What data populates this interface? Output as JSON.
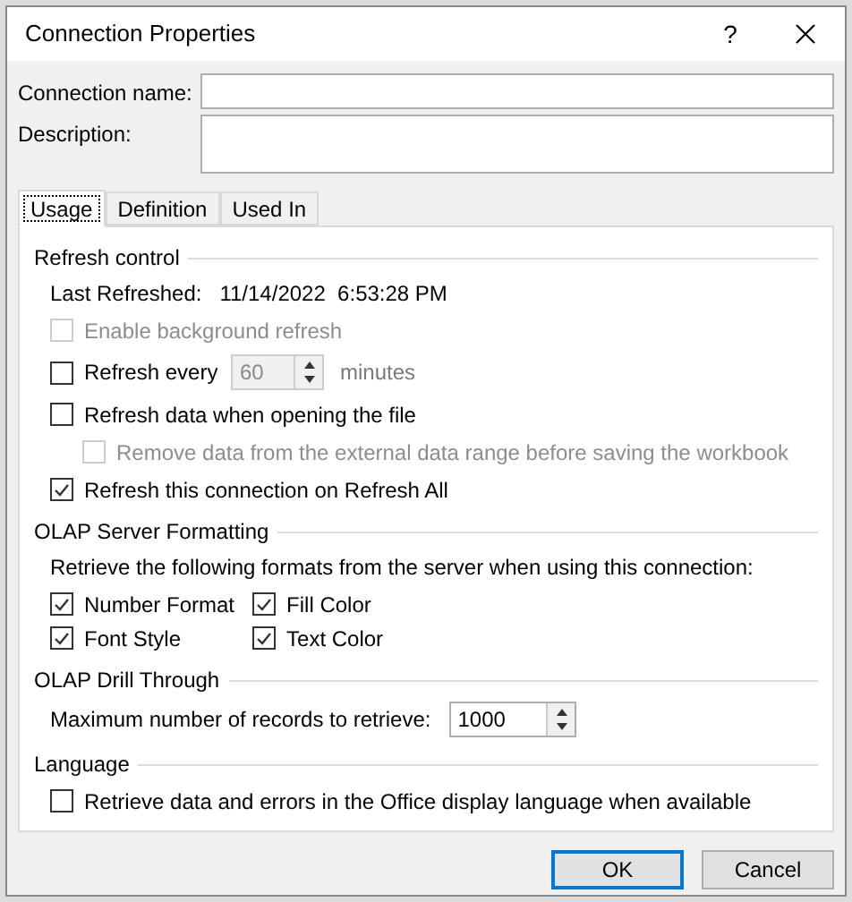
{
  "window": {
    "title": "Connection Properties",
    "help": "?"
  },
  "fields": [
    {
      "label": "Connection name:",
      "kind": "line"
    },
    {
      "label": "Description:",
      "kind": "area"
    }
  ],
  "tabs": [
    {
      "label": "Usage",
      "selected": true
    },
    {
      "label": "Definition",
      "selected": false
    },
    {
      "label": "Used In",
      "selected": false
    }
  ],
  "sections": [
    {
      "title": "Refresh control",
      "items": [
        {
          "kind": "info",
          "label": "Last Refreshed:",
          "value": "11/14/2022  6:53:28 PM"
        },
        {
          "kind": "checkbox",
          "label": "Enable background refresh",
          "checked": false,
          "disabled": true
        },
        {
          "kind": "checkbox-spin",
          "label": "Refresh every",
          "checked": false,
          "disabled": false,
          "value": "60",
          "value_disabled": true,
          "unit": "minutes"
        },
        {
          "kind": "checkbox",
          "label": "Refresh data when opening the file",
          "checked": false,
          "disabled": false,
          "children": [
            {
              "label": "Remove data from the external data range before saving the workbook",
              "checked": false,
              "disabled": true
            }
          ]
        },
        {
          "kind": "checkbox",
          "label": "Refresh this connection on Refresh All",
          "checked": true,
          "disabled": false
        }
      ]
    },
    {
      "title": "OLAP Server Formatting",
      "items": [
        {
          "kind": "text",
          "label": "Retrieve the following formats from the server when using this connection:"
        },
        {
          "kind": "grid",
          "options": [
            {
              "label": "Number Format",
              "checked": true
            },
            {
              "label": "Fill Color",
              "checked": true
            },
            {
              "label": "Font Style",
              "checked": true
            },
            {
              "label": "Text Color",
              "checked": true
            }
          ]
        }
      ]
    },
    {
      "title": "OLAP Drill Through",
      "items": [
        {
          "kind": "spin",
          "label": "Maximum number of records to retrieve:",
          "value": "1000"
        }
      ]
    },
    {
      "title": "Language",
      "items": [
        {
          "kind": "checkbox",
          "label": "Retrieve data and errors in the Office display language when available",
          "checked": false,
          "disabled": false
        }
      ]
    }
  ],
  "buttons": [
    {
      "label": "OK",
      "default": true
    },
    {
      "label": "Cancel",
      "default": false
    }
  ]
}
